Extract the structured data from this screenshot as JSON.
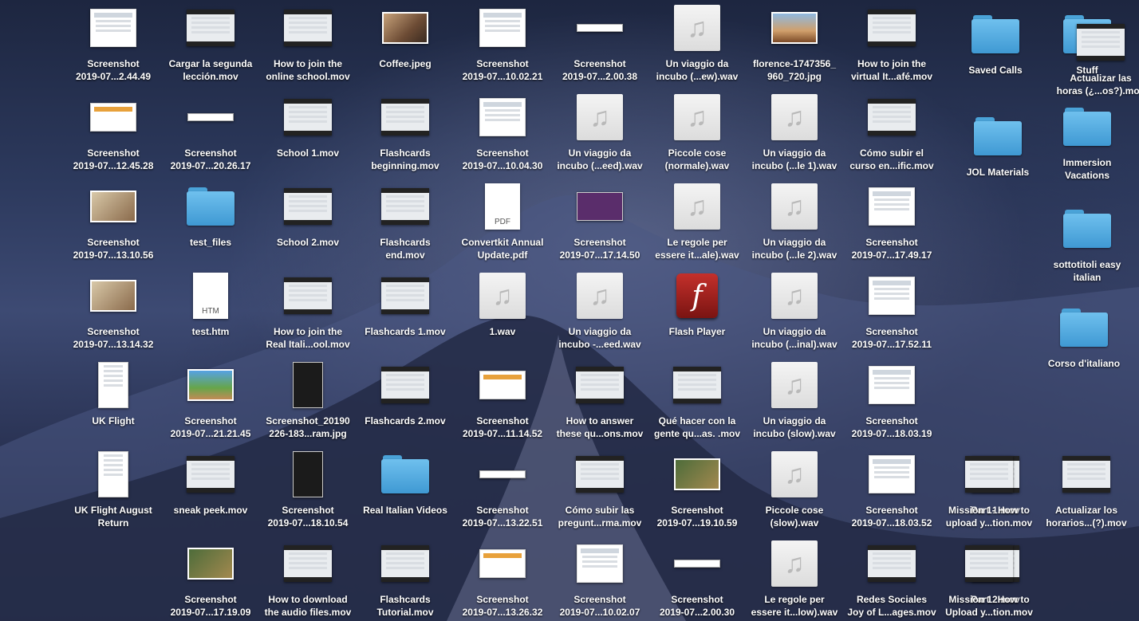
{
  "desktop": {
    "items": [
      {
        "label": "Screenshot\n2019-07...2.44.49",
        "kind": "doc"
      },
      {
        "label": "Cargar la segunda\nlección.mov",
        "kind": "mov"
      },
      {
        "label": "How to join the\nonline school.mov",
        "kind": "mov"
      },
      {
        "label": "Coffee.jpeg",
        "kind": "photo-a"
      },
      {
        "label": "Screenshot\n2019-07...10.02.21",
        "kind": "doc"
      },
      {
        "label": "Screenshot\n2019-07...2.00.38",
        "kind": "strip"
      },
      {
        "label": "Un viaggio da\nincubo (...ew).wav",
        "kind": "audio"
      },
      {
        "label": "florence-1747356_\n960_720.jpg",
        "kind": "photo-b"
      },
      {
        "label": "How to join the\nvirtual It...afé.mov",
        "kind": "mov"
      },
      {
        "label": "Saved Calls",
        "kind": "folder"
      },
      {
        "label": "Stuff",
        "kind": "folder"
      },
      {
        "label": "Actualizar las\nhoras (¿...os?).mov",
        "kind": "mov"
      },
      {
        "label": "Screenshot\n2019-07...12.45.28",
        "kind": "screen"
      },
      {
        "label": "Screenshot\n2019-07...20.26.17",
        "kind": "strip"
      },
      {
        "label": "School 1.mov",
        "kind": "mov"
      },
      {
        "label": "Flashcards\nbeginning.mov",
        "kind": "mov"
      },
      {
        "label": "Screenshot\n2019-07...10.04.30",
        "kind": "doc"
      },
      {
        "label": "Un viaggio da\nincubo (...eed).wav",
        "kind": "audio"
      },
      {
        "label": "Piccole cose\n(normale).wav",
        "kind": "audio"
      },
      {
        "label": "Un viaggio da\nincubo (...le 1).wav",
        "kind": "audio"
      },
      {
        "label": "Cómo subir el\ncurso en...ific.mov",
        "kind": "mov"
      },
      {
        "label": "JOL Materials",
        "kind": "folder"
      },
      {
        "label": "Immersion\nVacations",
        "kind": "folder"
      },
      {
        "label": "Screenshot\n2019-07...13.10.56",
        "kind": "photo-c"
      },
      {
        "label": "test_files",
        "kind": "folder"
      },
      {
        "label": "School 2.mov",
        "kind": "mov"
      },
      {
        "label": "Flashcards\nend.mov",
        "kind": "mov"
      },
      {
        "label": "Convertkit Annual\nUpdate.pdf",
        "kind": "pdf",
        "ext": "PDF"
      },
      {
        "label": "Screenshot\n2019-07...17.14.50",
        "kind": "purple"
      },
      {
        "label": "Le regole per\nessere it...ale).wav",
        "kind": "audio"
      },
      {
        "label": "Un viaggio da\nincubo (...le 2).wav",
        "kind": "audio"
      },
      {
        "label": "Screenshot\n2019-07...17.49.17",
        "kind": "doc"
      },
      {
        "label": "sottotitoli easy\nitalian",
        "kind": "folder"
      },
      {
        "label": "Screenshot\n2019-07...13.14.32",
        "kind": "photo-c"
      },
      {
        "label": "test.htm",
        "kind": "htm",
        "ext": "HTM"
      },
      {
        "label": "How to join the\nReal Itali...ool.mov",
        "kind": "mov"
      },
      {
        "label": "Flashcards 1.mov",
        "kind": "mov"
      },
      {
        "label": "1.wav",
        "kind": "audio"
      },
      {
        "label": "Un viaggio da\nincubo -...eed.wav",
        "kind": "audio"
      },
      {
        "label": "Flash Player",
        "kind": "flash"
      },
      {
        "label": "Un viaggio da\nincubo (...inal).wav",
        "kind": "audio"
      },
      {
        "label": "Screenshot\n2019-07...17.52.11",
        "kind": "doc"
      },
      {
        "label": "Corso d'italiano",
        "kind": "folder"
      },
      {
        "label": "UK Flight",
        "kind": "tall"
      },
      {
        "label": "Screenshot\n2019-07...21.21.45",
        "kind": "photo-d"
      },
      {
        "label": "Screenshot_20190\n226-183...ram.jpg",
        "kind": "tall-dark"
      },
      {
        "label": "Flashcards 2.mov",
        "kind": "mov"
      },
      {
        "label": "Screenshot\n2019-07...11.14.52",
        "kind": "screen"
      },
      {
        "label": "How to answer\nthese qu...ons.mov",
        "kind": "mov"
      },
      {
        "label": "Qué hacer con la\ngente qu...as. .mov",
        "kind": "mov"
      },
      {
        "label": "Un viaggio da\nincubo (slow).wav",
        "kind": "audio"
      },
      {
        "label": "Screenshot\n2019-07...18.03.19",
        "kind": "doc"
      },
      {
        "label": "UK Flight August\nReturn",
        "kind": "tall"
      },
      {
        "label": "sneak peek.mov",
        "kind": "mov"
      },
      {
        "label": "Screenshot\n2019-07...18.10.54",
        "kind": "tall-dark"
      },
      {
        "label": "Real Italian Videos",
        "kind": "folder"
      },
      {
        "label": "Screenshot\n2019-07...13.22.51",
        "kind": "strip"
      },
      {
        "label": "Cómo subir las\npregunt...rma.mov",
        "kind": "mov"
      },
      {
        "label": "Screenshot\n2019-07...19.10.59",
        "kind": "photo-e"
      },
      {
        "label": "Piccole cose\n(slow).wav",
        "kind": "audio"
      },
      {
        "label": "Screenshot\n2019-07...18.03.52",
        "kind": "doc"
      },
      {
        "label": "Part 1.mov",
        "kind": "mov"
      },
      {
        "label": "Mission 1- How to\nupload y...tion.mov",
        "kind": "mov"
      },
      {
        "label": "Actualizar los\nhorarios...(?).mov",
        "kind": "mov"
      },
      {
        "label": "Screenshot\n2019-07...17.19.09",
        "kind": "photo-e"
      },
      {
        "label": "How to download\nthe audio files.mov",
        "kind": "mov"
      },
      {
        "label": "Flashcards\nTutorial.mov",
        "kind": "mov"
      },
      {
        "label": "Screenshot\n2019-07...13.26.32",
        "kind": "screen"
      },
      {
        "label": "Screenshot\n2019-07...10.02.07",
        "kind": "doc"
      },
      {
        "label": "Screenshot\n2019-07...2.00.30",
        "kind": "strip"
      },
      {
        "label": "Le regole per\nessere it...low).wav",
        "kind": "audio"
      },
      {
        "label": "Redes Sociales\nJoy of L...ages.mov",
        "kind": "mov"
      },
      {
        "label": "Part 2.mov",
        "kind": "mov"
      },
      {
        "label": "Mission 1. How to\nUpload y...tion.mov",
        "kind": "mov"
      }
    ]
  }
}
